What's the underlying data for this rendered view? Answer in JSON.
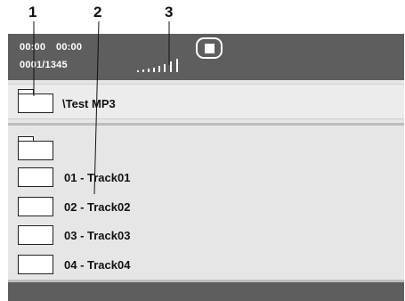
{
  "callouts": [
    "1",
    "2",
    "3"
  ],
  "status_bar": {
    "time_elapsed": "00:00",
    "time_total": "00:00",
    "track_counter": "0001/1345",
    "signal_icon": "signal-strength-icon",
    "mode_icon": "stop-icon",
    "background": "#5e5e5e"
  },
  "directory": {
    "folder_icon": "folder-icon",
    "path": "\\Test MP3"
  },
  "file_list": {
    "parent_folder_icon": "folder-icon",
    "tracks": [
      {
        "label": "01 - Track01",
        "icon": "file-icon"
      },
      {
        "label": "02 - Track02",
        "icon": "file-icon"
      },
      {
        "label": "03 - Track03",
        "icon": "file-icon"
      },
      {
        "label": "04 - Track04",
        "icon": "file-icon"
      }
    ]
  },
  "colors": {
    "screen_background": "#e6e6e6",
    "bar_background": "#5e5e5e",
    "separator": "#bdbdbd"
  }
}
